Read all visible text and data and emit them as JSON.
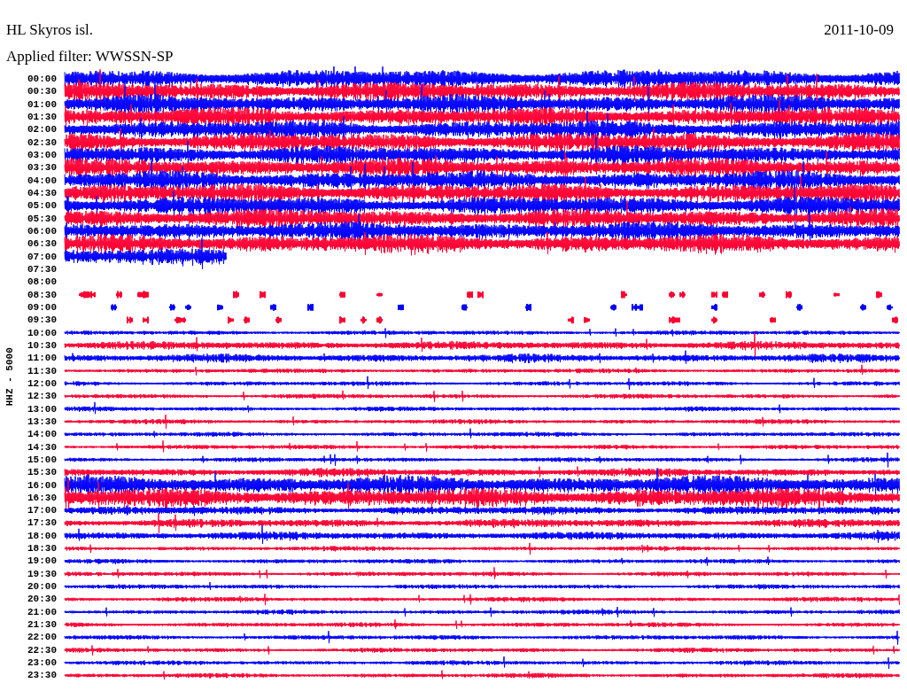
{
  "title": "HL Skyros isl.",
  "date": "2011-10-09",
  "filter": "Applied filter: WWSSN-SP",
  "axis_label": "HHZ - 5000",
  "rows": [
    {
      "time": "00:00",
      "color": "#0000ff",
      "kind": "heavy"
    },
    {
      "time": "00:30",
      "color": "#ff0033",
      "kind": "heavy"
    },
    {
      "time": "01:00",
      "color": "#0000ff",
      "kind": "heavy"
    },
    {
      "time": "01:30",
      "color": "#ff0033",
      "kind": "heavy"
    },
    {
      "time": "02:00",
      "color": "#0000ff",
      "kind": "heavy"
    },
    {
      "time": "02:30",
      "color": "#ff0033",
      "kind": "heavy"
    },
    {
      "time": "03:00",
      "color": "#0000ff",
      "kind": "heavy"
    },
    {
      "time": "03:30",
      "color": "#ff0033",
      "kind": "heavy"
    },
    {
      "time": "04:00",
      "color": "#0000ff",
      "kind": "heavy"
    },
    {
      "time": "04:30",
      "color": "#ff0033",
      "kind": "heavy"
    },
    {
      "time": "05:00",
      "color": "#0000ff",
      "kind": "heavy"
    },
    {
      "time": "05:30",
      "color": "#ff0033",
      "kind": "heavy"
    },
    {
      "time": "06:00",
      "color": "#0000ff",
      "kind": "heavy"
    },
    {
      "time": "06:30",
      "color": "#ff0033",
      "kind": "heavy"
    },
    {
      "time": "07:00",
      "color": "#0000ff",
      "kind": "partial"
    },
    {
      "time": "07:30",
      "kind": "empty"
    },
    {
      "time": "08:00",
      "kind": "empty"
    },
    {
      "time": "08:30",
      "color": "#ff0033",
      "kind": "sparse"
    },
    {
      "time": "09:00",
      "color": "#0000ff",
      "kind": "sparse"
    },
    {
      "time": "09:30",
      "color": "#ff0033",
      "kind": "sparse"
    },
    {
      "time": "10:00",
      "color": "#0000ff",
      "kind": "light"
    },
    {
      "time": "10:30",
      "color": "#ff0033",
      "kind": "moderate"
    },
    {
      "time": "11:00",
      "color": "#0000ff",
      "kind": "moderate"
    },
    {
      "time": "11:30",
      "color": "#ff0033",
      "kind": "light"
    },
    {
      "time": "12:00",
      "color": "#0000ff",
      "kind": "light"
    },
    {
      "time": "12:30",
      "color": "#ff0033",
      "kind": "light"
    },
    {
      "time": "13:00",
      "color": "#0000ff",
      "kind": "light"
    },
    {
      "time": "13:30",
      "color": "#ff0033",
      "kind": "light"
    },
    {
      "time": "14:00",
      "color": "#0000ff",
      "kind": "light"
    },
    {
      "time": "14:30",
      "color": "#ff0033",
      "kind": "light"
    },
    {
      "time": "15:00",
      "color": "#0000ff",
      "kind": "light"
    },
    {
      "time": "15:30",
      "color": "#ff0033",
      "kind": "moderate"
    },
    {
      "time": "16:00",
      "color": "#0000ff",
      "kind": "heavy"
    },
    {
      "time": "16:30",
      "color": "#ff0033",
      "kind": "heavy"
    },
    {
      "time": "17:00",
      "color": "#0000ff",
      "kind": "moderate"
    },
    {
      "time": "17:30",
      "color": "#ff0033",
      "kind": "moderate"
    },
    {
      "time": "18:00",
      "color": "#0000ff",
      "kind": "moderate"
    },
    {
      "time": "18:30",
      "color": "#ff0033",
      "kind": "light"
    },
    {
      "time": "19:00",
      "color": "#0000ff",
      "kind": "light"
    },
    {
      "time": "19:30",
      "color": "#ff0033",
      "kind": "light"
    },
    {
      "time": "20:00",
      "color": "#0000ff",
      "kind": "light"
    },
    {
      "time": "20:30",
      "color": "#ff0033",
      "kind": "light"
    },
    {
      "time": "21:00",
      "color": "#0000ff",
      "kind": "light"
    },
    {
      "time": "21:30",
      "color": "#ff0033",
      "kind": "light"
    },
    {
      "time": "22:00",
      "color": "#0000ff",
      "kind": "light"
    },
    {
      "time": "22:30",
      "color": "#ff0033",
      "kind": "light"
    },
    {
      "time": "23:00",
      "color": "#0000ff",
      "kind": "light"
    },
    {
      "time": "23:30",
      "color": "#ff0033",
      "kind": "light"
    }
  ]
}
